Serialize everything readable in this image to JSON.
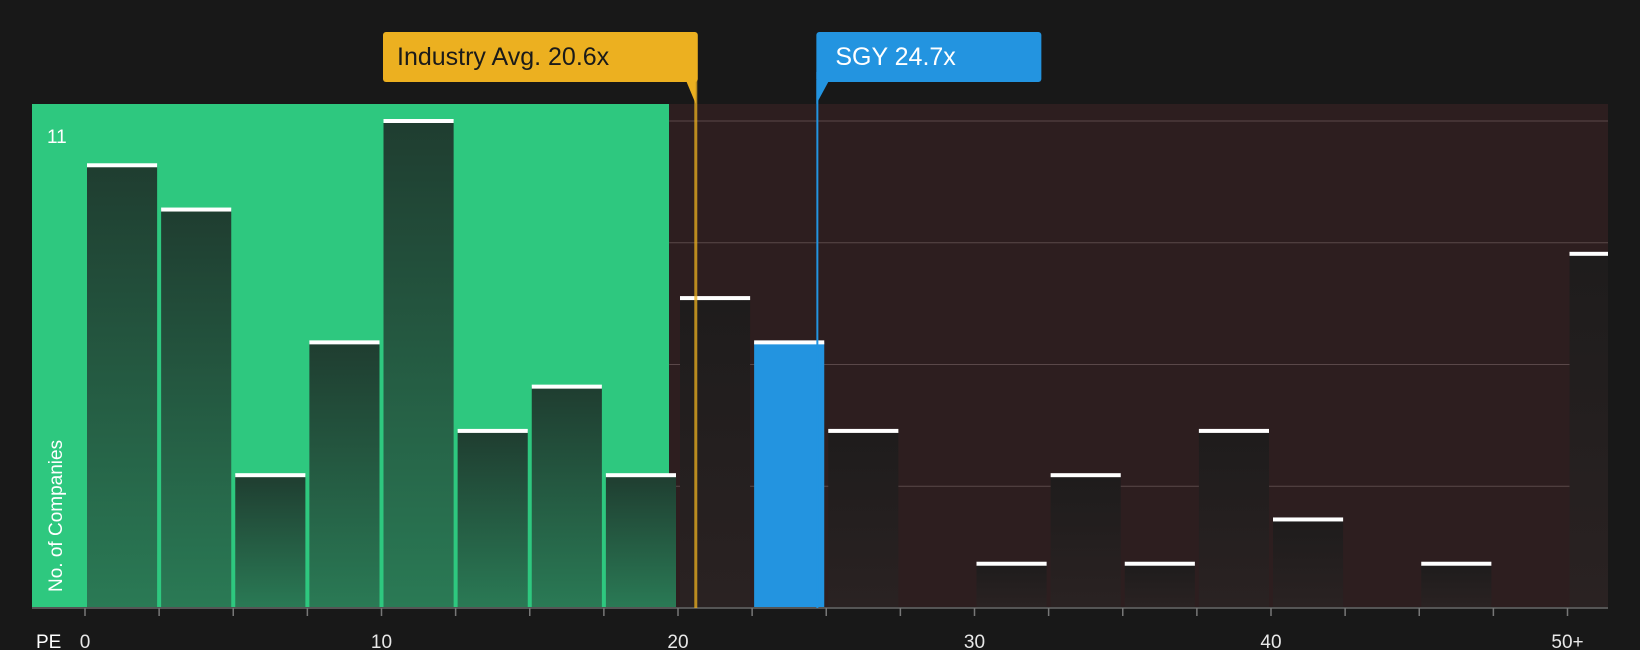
{
  "chart_data": {
    "type": "bar",
    "title": "",
    "xlabel": "PE",
    "ylabel": "No. of Companies",
    "x_ticks": [
      "0",
      "10",
      "20",
      "30",
      "40",
      "50+"
    ],
    "x_tick_values": [
      0,
      10,
      20,
      30,
      40,
      50
    ],
    "y_tick_labels": [
      "11"
    ],
    "ylim": [
      0,
      11
    ],
    "xlim": [
      -1.8,
      51.2
    ],
    "bin_width": 2.5,
    "bins": [
      {
        "start": 0.0,
        "count": 10
      },
      {
        "start": 2.5,
        "count": 9
      },
      {
        "start": 5.0,
        "count": 3
      },
      {
        "start": 7.5,
        "count": 6
      },
      {
        "start": 10.0,
        "count": 11
      },
      {
        "start": 12.5,
        "count": 4
      },
      {
        "start": 15.0,
        "count": 5
      },
      {
        "start": 17.5,
        "count": 3
      },
      {
        "start": 20.0,
        "count": 7
      },
      {
        "start": 22.5,
        "count": 6
      },
      {
        "start": 25.0,
        "count": 4
      },
      {
        "start": 30.0,
        "count": 1
      },
      {
        "start": 32.5,
        "count": 3
      },
      {
        "start": 35.0,
        "count": 1
      },
      {
        "start": 37.5,
        "count": 4
      },
      {
        "start": 40.0,
        "count": 2
      },
      {
        "start": 45.0,
        "count": 1
      },
      {
        "start": 50.0,
        "count": 8
      }
    ],
    "fair_region_end": 19.7,
    "industry_avg": {
      "label": "Industry Avg. 20.6x",
      "value": 20.6
    },
    "company": {
      "label": "SGY 24.7x",
      "value": 24.7,
      "bin_start": 22.5
    },
    "grid": true
  },
  "colors": {
    "background": "#181818",
    "fair_region": "#2ec87f",
    "expensive_region": "#2d1e1f",
    "bar_in_fair": "#1f3d30",
    "bar_in_expensive": "#241e1e",
    "bar_cap": "#ffffff",
    "company_bar": "#2394e0",
    "industry_callout": "#ecb020",
    "company_callout": "#2394e0",
    "gridline": "#5a4849"
  }
}
